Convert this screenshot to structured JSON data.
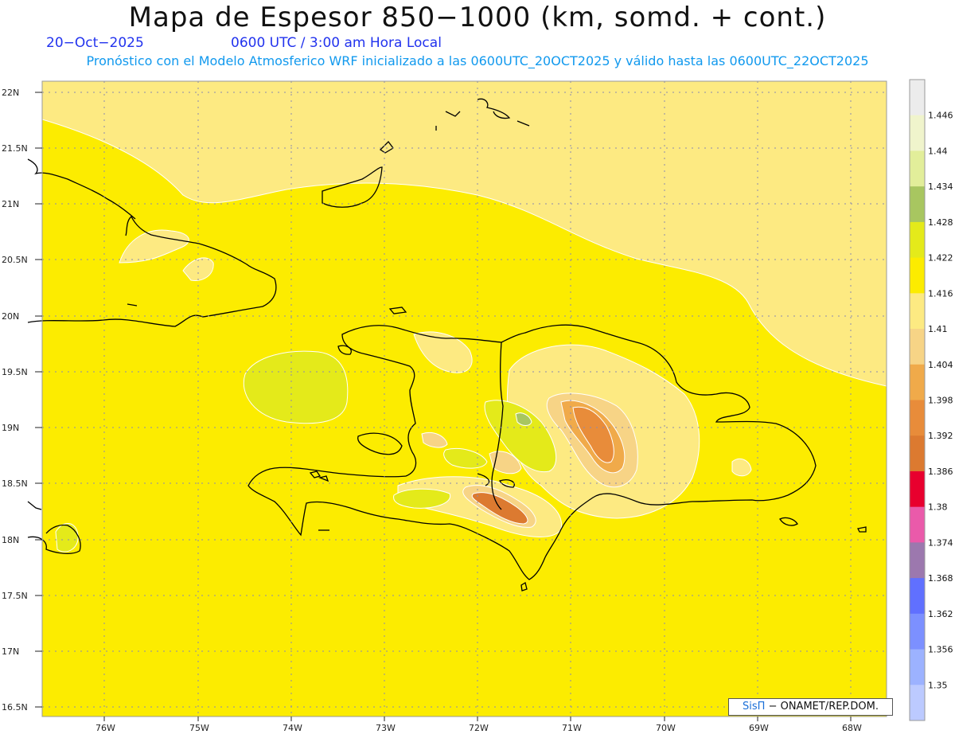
{
  "header": {
    "title": "Mapa de Espesor 850−1000 (km, somd. + cont.)",
    "date": "20−Oct−2025",
    "time": "0600 UTC / 3:00 am Hora Local",
    "description": "Pronóstico con el Modelo Atmosferico WRF inicializado a las 0600UTC_20OCT2025 y válido hasta las  0600UTC_22OCT2025"
  },
  "map": {
    "lat_labels": [
      "22N",
      "21.5N",
      "21N",
      "20.5N",
      "20N",
      "19.5N",
      "19N",
      "18.5N",
      "18N",
      "17.5N",
      "17N",
      "16.5N"
    ],
    "lon_labels": [
      "76W",
      "75W",
      "74W",
      "73W",
      "72W",
      "71W",
      "70W",
      "69W",
      "68W"
    ],
    "lat_range": [
      16.5,
      22.0
    ],
    "lon_range": [
      -76.67,
      -67.6
    ],
    "background_color": "#fcec00",
    "coastline_color": "#000000",
    "gridline_style": "dotted"
  },
  "colorbar": {
    "levels": [
      "1.446",
      "1.44",
      "1.434",
      "1.428",
      "1.422",
      "1.416",
      "1.41",
      "1.404",
      "1.398",
      "1.392",
      "1.386",
      "1.38",
      "1.374",
      "1.368",
      "1.362",
      "1.356",
      "1.35"
    ],
    "colors": [
      "#ececec",
      "#f0f4cc",
      "#e2ee9a",
      "#a8c660",
      "#e4ea1a",
      "#fcec00",
      "#fdea82",
      "#f7d486",
      "#f0aa4a",
      "#e88c3a",
      "#dc7a30",
      "#e8002e",
      "#ea5aaa",
      "#9c78ae",
      "#6070ff",
      "#7c90ff",
      "#9cb2ff",
      "#bccaff"
    ]
  },
  "credit": {
    "brand": "SisΠ",
    "text": "− ONAMET/REP.DOM."
  }
}
